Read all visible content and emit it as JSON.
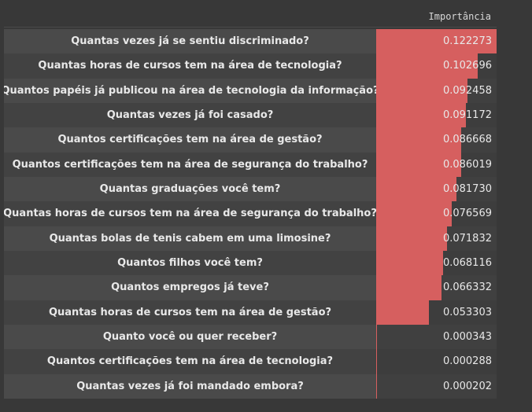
{
  "column_header": "Importância",
  "accent_color": "#d65f5f",
  "rows": [
    {
      "label": "Quantas vezes já se sentiu discriminado?",
      "value": "0.122273",
      "num": 0.122273
    },
    {
      "label": "Quantas horas de cursos tem na área de tecnologia?",
      "value": "0.102696",
      "num": 0.102696
    },
    {
      "label": "Quantos papéis já publicou na área de tecnologia da informação?",
      "value": "0.092458",
      "num": 0.092458
    },
    {
      "label": "Quantas vezes já foi casado?",
      "value": "0.091172",
      "num": 0.091172
    },
    {
      "label": "Quantos certificações tem na área de gestão?",
      "value": "0.086668",
      "num": 0.086668
    },
    {
      "label": "Quantos certificações tem na área de segurança do trabalho?",
      "value": "0.086019",
      "num": 0.086019
    },
    {
      "label": "Quantas graduações você tem?",
      "value": "0.081730",
      "num": 0.08173
    },
    {
      "label": "Quantas horas de cursos tem na área de segurança do trabalho?",
      "value": "0.076569",
      "num": 0.076569
    },
    {
      "label": "Quantas bolas de tenis cabem em uma limosine?",
      "value": "0.071832",
      "num": 0.071832
    },
    {
      "label": "Quantos filhos você tem?",
      "value": "0.068116",
      "num": 0.068116
    },
    {
      "label": "Quantos empregos já teve?",
      "value": "0.066332",
      "num": 0.066332
    },
    {
      "label": "Quantas horas de cursos tem na área de gestão?",
      "value": "0.053303",
      "num": 0.053303
    },
    {
      "label": "Quanto você ou quer receber?",
      "value": "0.000343",
      "num": 0.000343
    },
    {
      "label": "Quantos certificações tem na área de tecnologia?",
      "value": "0.000288",
      "num": 0.000288
    },
    {
      "label": "Quantas vezes já foi mandado embora?",
      "value": "0.000202",
      "num": 0.000202
    }
  ]
}
